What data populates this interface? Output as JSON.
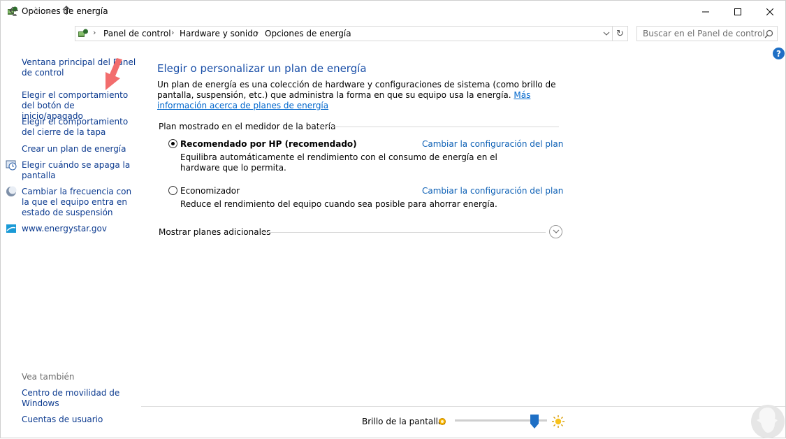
{
  "window": {
    "title": "Opciones de energía"
  },
  "address": {
    "crumbs": [
      "Panel de control",
      "Hardware y sonido",
      "Opciones de energía"
    ],
    "search_placeholder": "Buscar en el Panel de control"
  },
  "help_label": "?",
  "left": {
    "links": [
      "Ventana principal del Panel de control",
      "Elegir el comportamiento del botón de inicio/apagado",
      "Elegir el comportamiento del cierre de la tapa",
      "Crear un plan de energía",
      "Elegir cuándo se apaga la pantalla",
      "Cambiar la frecuencia con la que el equipo entra en estado de suspensión",
      "www.energystar.gov"
    ],
    "see_also_label": "Vea también",
    "see_also": [
      "Centro de movilidad de Windows",
      "Cuentas de usuario"
    ]
  },
  "main": {
    "title": "Elegir o personalizar un plan de energía",
    "description": "Un plan de energía es una colección de hardware y configuraciones de sistema (como brillo de pantalla, suspensión, etc.) que administra la forma en que su equipo usa la energía.",
    "more_info_link": "Más información acerca de planes de energía",
    "group_label": "Plan mostrado en el medidor de la batería",
    "plans": [
      {
        "name": "Recomendado por HP (recomendado)",
        "selected": true,
        "description": "Equilibra automáticamente el rendimiento con el consumo de energía en el hardware que lo permita.",
        "change_link": "Cambiar la configuración del plan"
      },
      {
        "name": "Economizador",
        "selected": false,
        "description": "Reduce el rendimiento del equipo cuando sea posible para ahorrar energía.",
        "change_link": "Cambiar la configuración del plan"
      }
    ],
    "more_plans_label": "Mostrar planes adicionales"
  },
  "bottom": {
    "brightness_label": "Brillo de la pantalla:",
    "brightness_level": 0.86
  },
  "colors": {
    "link": "#0b3a8f",
    "title": "#1a4fa8",
    "accent": "#1e6fc5",
    "annotation_arrow": "#f26d6d"
  }
}
